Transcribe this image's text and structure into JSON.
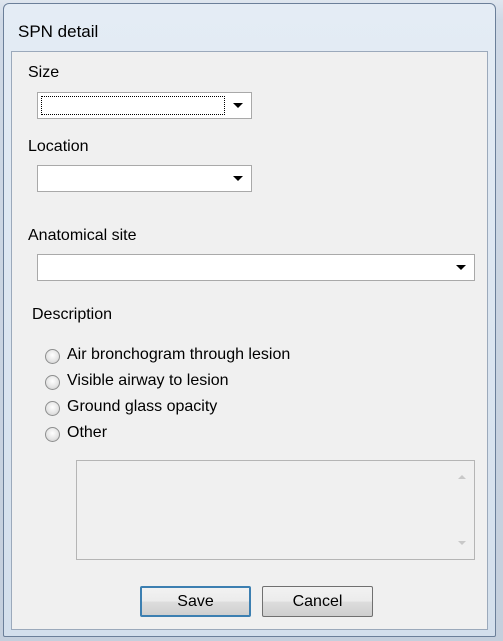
{
  "window": {
    "title": "SPN detail"
  },
  "fields": {
    "size": {
      "label": "Size",
      "value": ""
    },
    "location": {
      "label": "Location",
      "value": ""
    },
    "anatomical_site": {
      "label": "Anatomical site",
      "value": ""
    }
  },
  "description": {
    "label": "Description",
    "options": [
      "Air bronchogram through lesion",
      "Visible airway to lesion",
      "Ground glass opacity",
      "Other"
    ],
    "other_text": ""
  },
  "buttons": {
    "save": "Save",
    "cancel": "Cancel"
  },
  "icons": {
    "dropdown": "chevron-down-icon",
    "radio": "radio-button-icon"
  }
}
